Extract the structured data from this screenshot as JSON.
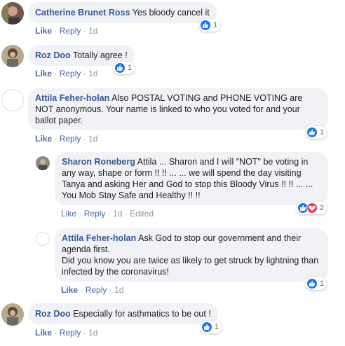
{
  "comments": [
    {
      "author": "Catherine Brunet Ross",
      "text": "Yes bloody cancel it",
      "actions": {
        "like": "Like",
        "reply": "Reply",
        "time": "1d"
      },
      "reactions": {
        "count": "1",
        "types": [
          "like"
        ]
      }
    },
    {
      "author": "Roz Doo",
      "text": "Totally agree !",
      "actions": {
        "like": "Like",
        "reply": "Reply",
        "time": "1d"
      },
      "reactions": {
        "count": "1",
        "types": [
          "like"
        ]
      }
    },
    {
      "author": "Attila Feher-holan",
      "text": "Also POSTAL VOTING and PHONE VOTING are NOT anonymous. Your name is linked to who you voted for and your ballot paper.",
      "actions": {
        "like": "Like",
        "reply": "Reply",
        "time": "1d"
      },
      "reactions": {
        "count": "1",
        "types": [
          "like"
        ]
      }
    },
    {
      "author": "Sharon Roneberg",
      "text": "Attila ... Sharon and I will \"NOT\" be voting in any way, shape or form !! !! ... ... we will spend the day visiting Tanya and asking Her and God to stop this Bloody Virus !! !! ... ... You Mob Stay Safe and Healthy !! !!",
      "actions": {
        "like": "Like",
        "reply": "Reply",
        "time": "1d",
        "edited": "Edited"
      },
      "reactions": {
        "count": "2",
        "types": [
          "like",
          "love"
        ]
      }
    },
    {
      "author": "Attila Feher-holan",
      "text": "Ask God to stop our government and their agenda first.",
      "text2": "Did you know you are twice as likely to get struck by lightning than infected by the coronavirus!",
      "actions": {
        "like": "Like",
        "reply": "Reply",
        "time": "1d"
      },
      "reactions": {
        "count": "1",
        "types": [
          "like"
        ]
      }
    },
    {
      "author": "Roz Doo",
      "text": "Especially for asthmatics to be out !",
      "actions": {
        "like": "Like",
        "reply": "Reply",
        "time": "1d"
      },
      "reactions": {
        "count": "1",
        "types": [
          "like"
        ]
      }
    }
  ],
  "colors": {
    "author": "#385898",
    "bubble": "#f0f2f5",
    "like": "#1877f2",
    "love": "#f33e58"
  },
  "separator": "·"
}
